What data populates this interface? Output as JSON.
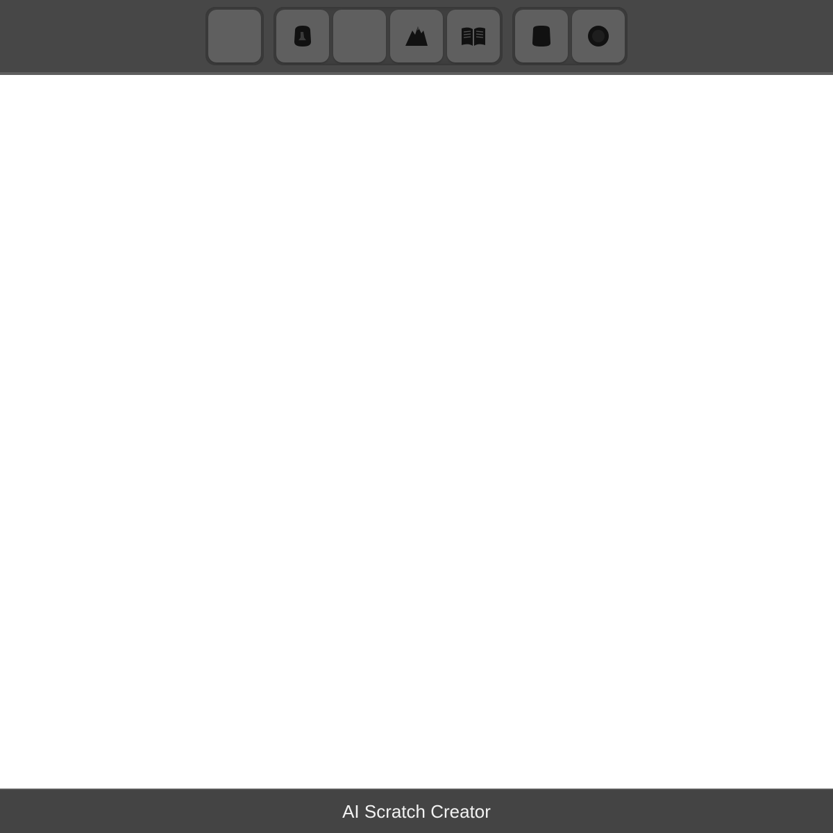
{
  "toolbar": {
    "groups": [
      {
        "buttons": [
          {
            "icon": "blank-icon"
          }
        ]
      },
      {
        "buttons": [
          {
            "icon": "sprite-icon"
          },
          {
            "icon": "blank-icon"
          },
          {
            "icon": "mountain-icon"
          },
          {
            "icon": "open-book-icon"
          }
        ]
      },
      {
        "buttons": [
          {
            "icon": "stop-icon"
          },
          {
            "icon": "record-icon"
          }
        ]
      }
    ]
  },
  "footer": {
    "title": "AI Scratch Creator"
  },
  "colors": {
    "toolbar_bg": "#474747",
    "button_bg": "#5f5f5f",
    "footer_bg": "#444444",
    "canvas_bg": "#ffffff",
    "footer_text": "#f2f2f2"
  }
}
